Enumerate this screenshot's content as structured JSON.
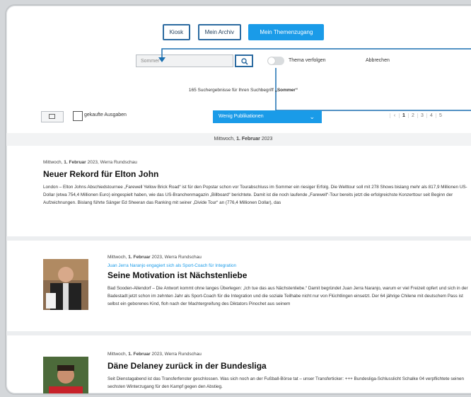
{
  "nav": {
    "kiosk": "Kiosk",
    "archive": "Mein Archiv",
    "topics": "Mein Themenzugang"
  },
  "search": {
    "value": "Sommer",
    "follow_label": "Thema verfolgen",
    "cancel_label": "Abbrechen"
  },
  "results": {
    "count_prefix": "165 Suchergebnisse für Ihren Suchbegriff ",
    "query": "„Sommer“"
  },
  "toolbar": {
    "purchased_label": "gekaufte Ausgaben",
    "sort_label": "Wenig Publikationen",
    "pages": [
      "1",
      "2",
      "3",
      "4",
      "5"
    ]
  },
  "date_band": {
    "prefix": "Mittwoch, ",
    "date": "1. Februar",
    "year": " 2023"
  },
  "articles": [
    {
      "meta_prefix": "Mittwoch, ",
      "meta_date": "1. Februar",
      "meta_suffix": " 2023, Werra Rundschau",
      "title": "Neuer Rekord für Elton John",
      "body": "London – Elton Johns Abschiedstournee „Farewell Yellow Brick Road“ ist für den Popstar schon vor Tourabschluss im Sommer ein riesiger Erfolg. Die Welttour soll mit 278 Shows bislang mehr als 817,9 Millionen US-Dollar (etwa 754,4 Millionen Euro) eingespielt haben, wie das US-Branchenmagazin „Billboard“ berichtete. Damit ist die noch laufende „Farewell“-Tour bereits jetzt die erfolgreichste Konzerttour seit Beginn der Aufzeichnungen. Bislang führte Sänger Ed Sheeran das Ranking mit seiner „Divide Tour“ an (776,4 Millionen Dollar), das"
    },
    {
      "meta_prefix": "Mittwoch, ",
      "meta_date": "1. Februar",
      "meta_suffix": " 2023, Werra Rundschau",
      "kicker": "Juan Jerra Naranjo engagiert sich als Sport-Coach für Integration",
      "title": "Seine Motivation ist Nächstenliebe",
      "body": "Bad Sooden-Allendorf – Die Antwort kommt ohne langes Überlegen: „Ich tue das aus Nächstenliebe.“ Damit begründet Juan Jerra Naranjo, warum er viel Freizeit opfert und sich in der Badestadt jetzt schon im zehnten Jahr als Sport-Coach für die Integration und die soziale Teilhabe nicht nur von Flüchtlingen einsetzt. Der 64 jährige Chilene mit deutschem Pass ist selbst ein geborenes Kind, floh nach der Machtergreifung des Diktators Pinochet aus seinem"
    },
    {
      "meta_prefix": "Mittwoch, ",
      "meta_date": "1. Februar",
      "meta_suffix": " 2023, Werra Rundschau",
      "title": "Däne Delaney zurück in der Bundesliga",
      "body": "Seit Dienstagabend ist das Transferfenster geschlossen. Was sich noch an der Fußball-Börse tat – unser Transferticker: +++ Bundesliga-Schlusslicht Schalke 04 verpflichtete seinen sechsten Winterzugang für den Kampf gegen den Abstieg."
    }
  ],
  "colors": {
    "accent": "#1a9be8",
    "nav_border": "#2b6aa0",
    "frame": "#c3c6c9"
  }
}
